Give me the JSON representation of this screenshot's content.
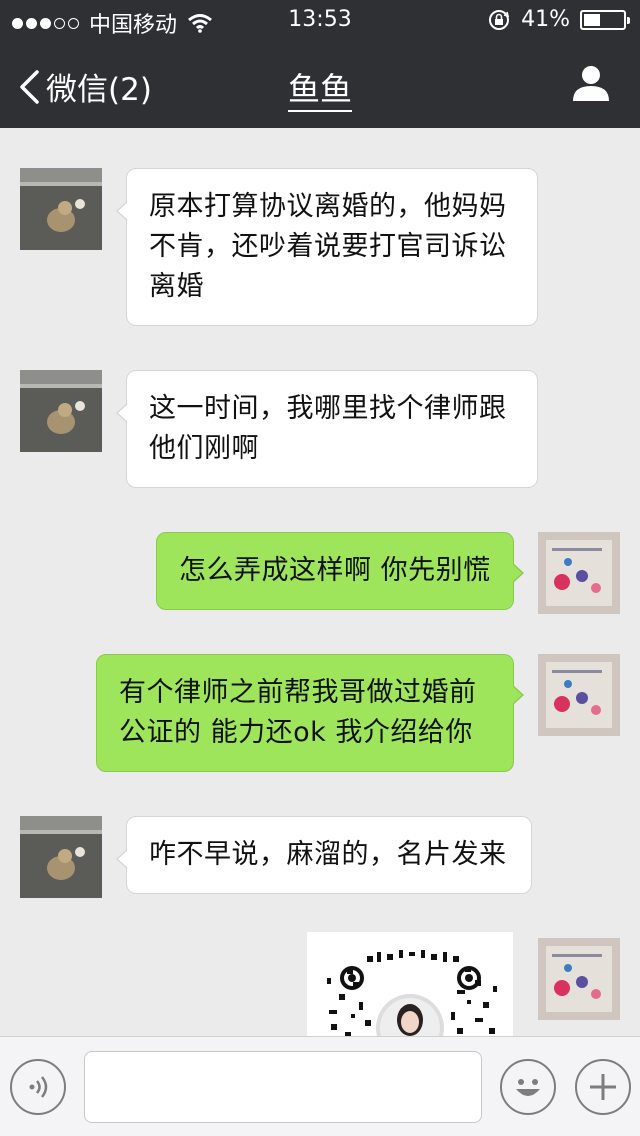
{
  "status_bar": {
    "carrier": "中国移动",
    "time": "13:53",
    "battery_percent": "41%",
    "battery_level": 0.41,
    "signal_bars_filled": 3,
    "signal_bars_total": 5
  },
  "nav": {
    "back_label": "微信(2)",
    "title": "鱼鱼"
  },
  "messages": [
    {
      "side": "in",
      "text": "原本打算协议离婚的，他妈妈不肯，还吵着说要打官司诉讼离婚"
    },
    {
      "side": "in",
      "text": "这一时间，我哪里找个律师跟他们刚啊"
    },
    {
      "side": "out",
      "text": "怎么弄成这样啊 你先别慌"
    },
    {
      "side": "out",
      "text": "有个律师之前帮我哥做过婚前公证的 能力还ok 我介绍给你"
    },
    {
      "side": "in",
      "text": "咋不早说，麻溜的，名片发来"
    },
    {
      "side": "out",
      "type": "qr-card"
    }
  ],
  "input": {
    "value": "",
    "voice_icon": "voice-icon",
    "emoji_icon": "emoji-icon",
    "plus_icon": "plus-icon"
  },
  "colors": {
    "nav_background": "#2e3033",
    "chat_background": "#ebebeb",
    "outgoing_bubble": "#9fe55c",
    "incoming_bubble": "#ffffff"
  }
}
